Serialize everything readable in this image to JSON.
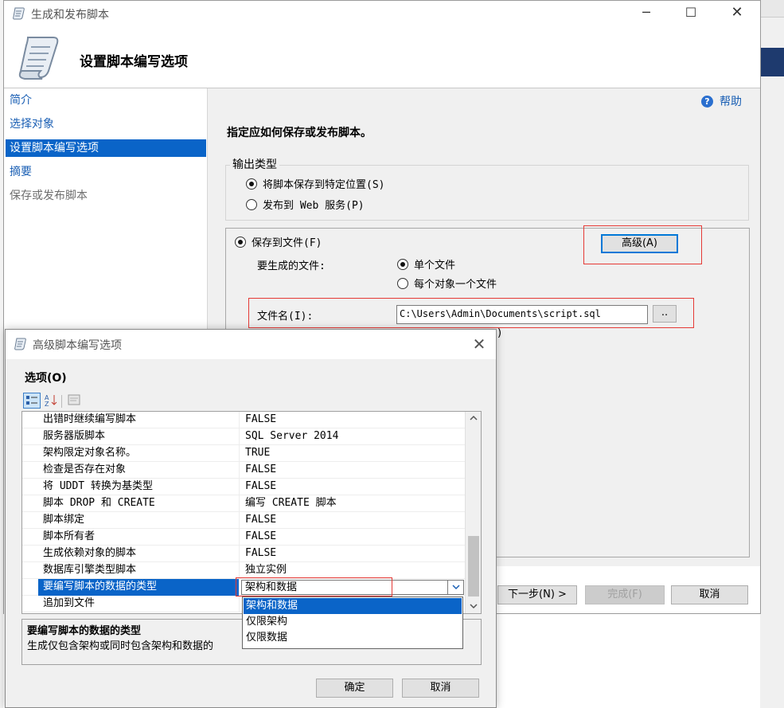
{
  "main_window": {
    "title": "生成和发布脚本",
    "header_title": "设置脚本编写选项",
    "nav_items": [
      {
        "label": "简介",
        "state": "link"
      },
      {
        "label": "选择对象",
        "state": "link"
      },
      {
        "label": "设置脚本编写选项",
        "state": "selected"
      },
      {
        "label": "摘要",
        "state": "link"
      },
      {
        "label": "保存或发布脚本",
        "state": "disabled"
      }
    ],
    "help_label": "帮助",
    "instruction": "指定应如何保存或发布脚本。",
    "output_type": {
      "legend": "输出类型",
      "option_save": "将脚本保存到特定位置(S)",
      "option_publish": "发布到 Web 服务(P)"
    },
    "save_to_file": {
      "label": "保存到文件(F)",
      "advanced_button": "高级(A)",
      "files_label": "要生成的文件:",
      "single_file": "单个文件",
      "per_object": "每个对象一个文件",
      "filename_label": "文件名(I):",
      "filename_value": "C:\\Users\\Admin\\Documents\\script.sql",
      "browse_button": ".."
    },
    "footer": {
      "next_button": "下一步(N) >",
      "finish_button": "完成(F)",
      "cancel_button": "取消"
    }
  },
  "advanced_dialog": {
    "title": "高级脚本编写选项",
    "options_label": "选项(O)",
    "rows": [
      {
        "name": "出错时继续编写脚本",
        "value": "FALSE"
      },
      {
        "name": "服务器版脚本",
        "value": "SQL Server 2014"
      },
      {
        "name": "架构限定对象名称。",
        "value": "TRUE"
      },
      {
        "name": "检查是否存在对象",
        "value": "FALSE"
      },
      {
        "name": "将 UDDT 转换为基类型",
        "value": "FALSE"
      },
      {
        "name": "脚本 DROP 和 CREATE",
        "value": "编写 CREATE 脚本"
      },
      {
        "name": "脚本绑定",
        "value": "FALSE"
      },
      {
        "name": "脚本所有者",
        "value": "FALSE"
      },
      {
        "name": "生成依赖对象的脚本",
        "value": "FALSE"
      },
      {
        "name": "数据库引擎类型脚本",
        "value": "独立实例"
      },
      {
        "name": "要编写脚本的数据的类型",
        "value": "架构和数据"
      },
      {
        "name": "追加到文件",
        "value": ""
      }
    ],
    "dropdown_options": [
      "架构和数据",
      "仅限架构",
      "仅限数据"
    ],
    "description_title": "要编写脚本的数据的类型",
    "description_text": "生成仅包含架构或同时包含架构和数据的",
    "ok_button": "确定",
    "cancel_button": "取消"
  }
}
